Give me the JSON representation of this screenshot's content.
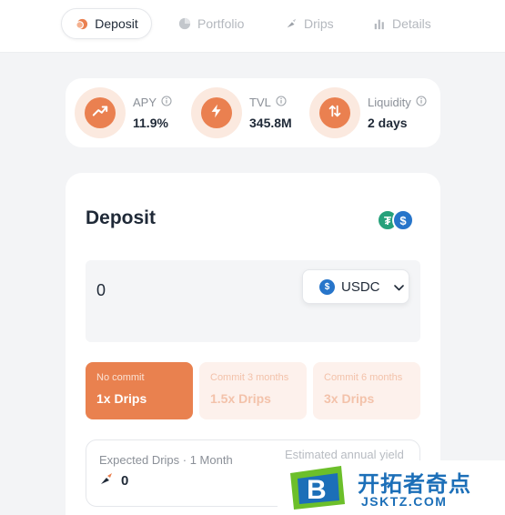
{
  "tabs": [
    {
      "label": "Deposit",
      "icon": "deposit-icon",
      "active": true
    },
    {
      "label": "Portfolio",
      "icon": "pie-chart-icon",
      "active": false
    },
    {
      "label": "Drips",
      "icon": "drip-icon",
      "active": false
    },
    {
      "label": "Details",
      "icon": "bar-chart-icon",
      "active": false
    }
  ],
  "stats": [
    {
      "label": "APY",
      "value": "11.9%",
      "icon": "trend-up-icon"
    },
    {
      "label": "TVL",
      "value": "345.8M",
      "icon": "lightning-icon"
    },
    {
      "label": "Liquidity",
      "value": "2 days",
      "icon": "swap-arrows-icon"
    }
  ],
  "deposit": {
    "title": "Deposit",
    "amount": "0",
    "token": "USDC",
    "tokens": [
      "USDT",
      "USDC"
    ],
    "commit_options": [
      {
        "label": "No commit",
        "multiplier": "1x Drips",
        "selected": true
      },
      {
        "label": "Commit 3 months",
        "multiplier": "1.5x Drips",
        "selected": false
      },
      {
        "label": "Commit 6 months",
        "multiplier": "3x Drips",
        "selected": false
      }
    ],
    "expected": {
      "label": "Expected Drips · 1 Month",
      "value": "0",
      "right_label": "Estimated annual yield"
    }
  },
  "watermark": {
    "title": "开拓者奇点",
    "subtitle": "JSKTZ.COM",
    "logo_letter": "B"
  },
  "colors": {
    "accent": "#ea8050",
    "accent_light": "#fbe9df",
    "usdt": "#26a17b",
    "usdc": "#2775ca",
    "watermark_blue": "#1c6fb8"
  }
}
